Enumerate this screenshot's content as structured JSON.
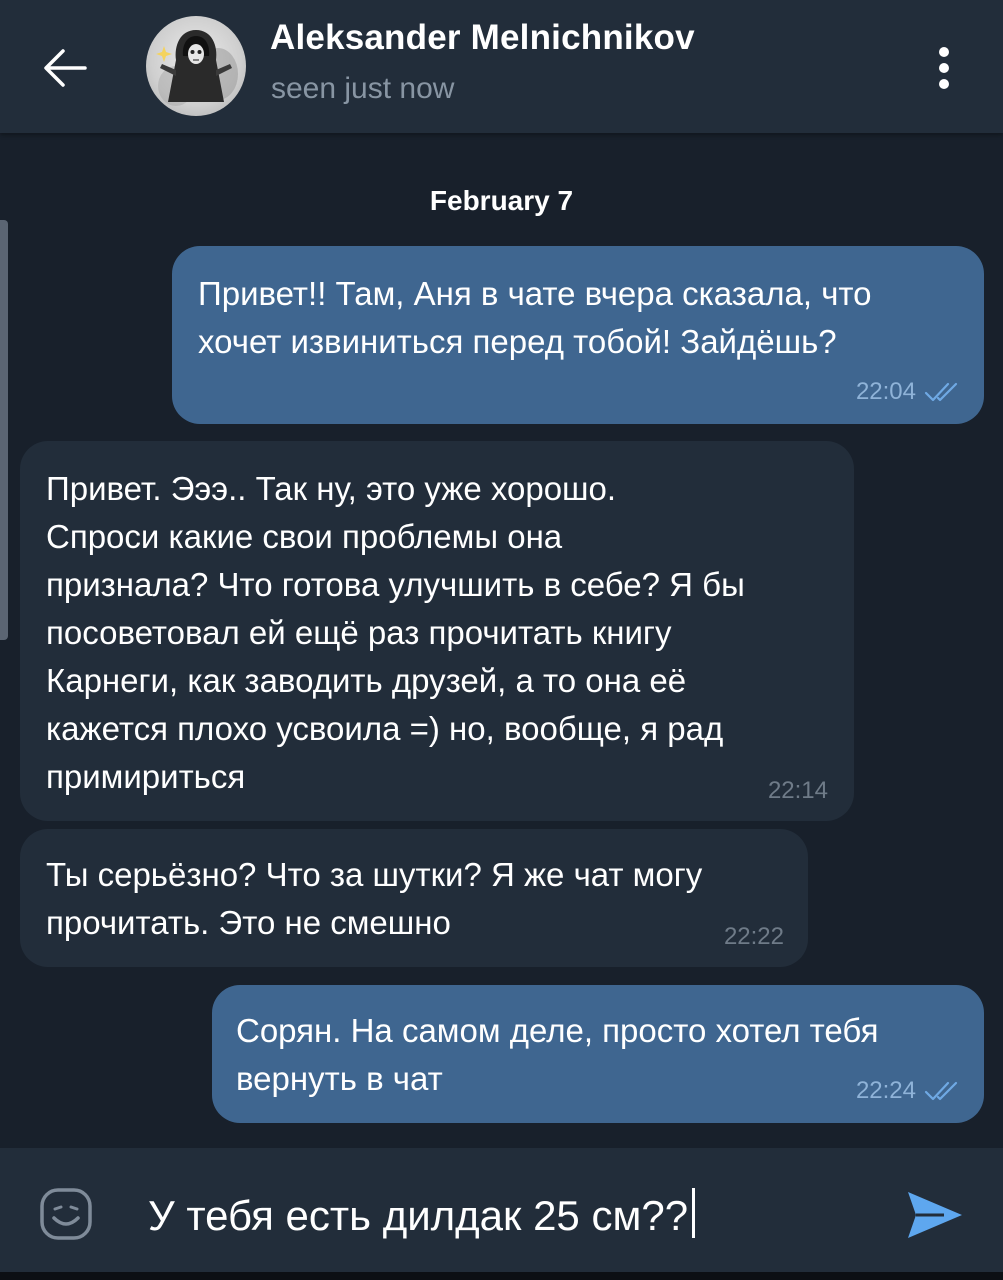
{
  "header": {
    "back_icon": "arrow-left-icon",
    "title": "Aleksander Melnichnikov",
    "status": "seen just now",
    "menu_icon": "more-vertical-icon"
  },
  "chat": {
    "date_label": "February 7",
    "messages": [
      {
        "direction": "outgoing",
        "text": "Привет!! Там, Аня в чате вчера сказала, что\nхочет извиниться перед тобой! Зайдёшь?",
        "time": "22:04",
        "read_icon": "double-check-icon"
      },
      {
        "direction": "incoming",
        "text": "Привет. Эээ.. Так ну, это уже хорошо.\nСпроси какие свои проблемы она\nпризнала? Что готова улучшить в себе? Я бы\nпосоветовал ей ещё раз прочитать книгу\nКарнеги, как заводить друзей, а то она её\nкажется плохо усвоила =) но, вообще, я рад\nпримириться",
        "time": "22:14"
      },
      {
        "direction": "incoming",
        "text": "Ты серьёзно? Что за шутки? Я же чат могу\nпрочитать. Это не смешно",
        "time": "22:22"
      },
      {
        "direction": "outgoing",
        "text": "Сорян. На самом деле, просто хотел тебя\nвернуть в чат",
        "time": "22:24",
        "read_icon": "double-check-icon"
      }
    ]
  },
  "composer": {
    "emoji_icon": "emoji-icon",
    "value": "У тебя есть дилдак 25 см??",
    "send_icon": "send-icon"
  },
  "colors": {
    "background": "#18202b",
    "header": "#222d3a",
    "outgoing_bubble": "#3f6690",
    "incoming_bubble": "#222d3a",
    "accent": "#5ea7ef",
    "muted_text": "#8895a3"
  }
}
